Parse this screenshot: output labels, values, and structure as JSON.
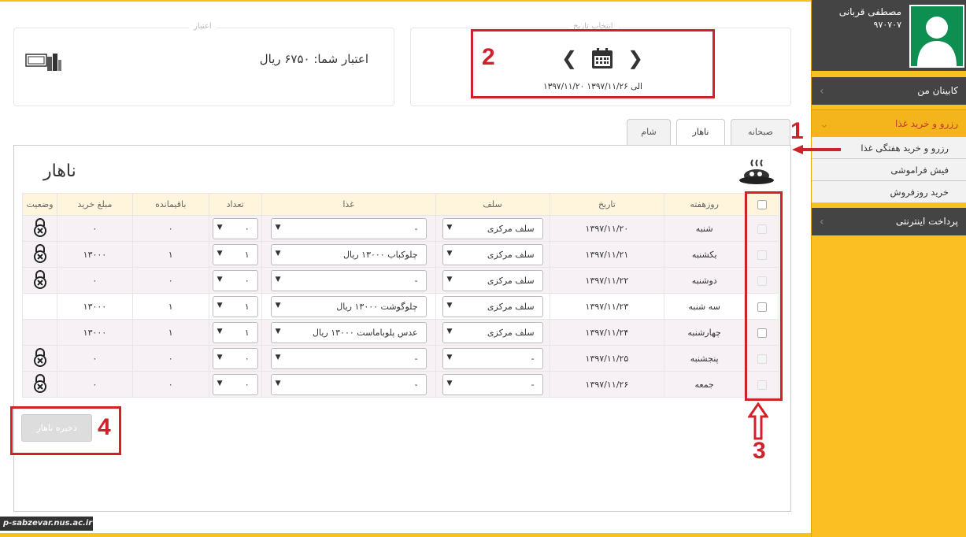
{
  "profile": {
    "name": "مصطفی قربانی",
    "id": "۹۷۰۷۰۷"
  },
  "menu": {
    "cabinet": "کابینان من",
    "reserve": "رزرو و خرید غذا",
    "sub": [
      "رزرو و خرید هفتگی غذا",
      "فیش فراموشی",
      "خرید روزفروش"
    ],
    "payment": "پرداخت اینترنتی"
  },
  "credit": {
    "legend": "اعتبار",
    "text": "اعتبار شما: ۶۷۵۰ ریال"
  },
  "date": {
    "legend": "انتخاب تاریخ",
    "range": "۱۳۹۷/۱۱/۲۰ الی ۱۳۹۷/۱۱/۲۶"
  },
  "tabs": [
    "صبحانه",
    "ناهار",
    "شام"
  ],
  "section_title": "ناهار",
  "table": {
    "headers": [
      "روزهفته",
      "تاریخ",
      "سلف",
      "غذا",
      "تعداد",
      "باقیمانده",
      "مبلغ خرید",
      "وضعیت"
    ],
    "rows": [
      {
        "day": "شنبه",
        "date": "۱۳۹۷/۱۱/۲۰",
        "self": "سلف مرکزی",
        "food": "-",
        "count": "۰",
        "remain": "۰",
        "price": "۰",
        "locked": true,
        "disabled": true
      },
      {
        "day": "یکشنبه",
        "date": "۱۳۹۷/۱۱/۲۱",
        "self": "سلف مرکزی",
        "food": "چلوکباب ۱۳۰۰۰ ریال",
        "count": "۱",
        "remain": "۱",
        "price": "۱۳۰۰۰",
        "locked": true,
        "disabled": true
      },
      {
        "day": "دوشنبه",
        "date": "۱۳۹۷/۱۱/۲۲",
        "self": "سلف مرکزی",
        "food": "-",
        "count": "۰",
        "remain": "۰",
        "price": "۰",
        "locked": true,
        "disabled": true
      },
      {
        "day": "سه شنبه",
        "date": "۱۳۹۷/۱۱/۲۳",
        "self": "سلف مرکزی",
        "food": "چلوگوشت ۱۳۰۰۰ ریال",
        "count": "۱",
        "remain": "۱",
        "price": "۱۳۰۰۰",
        "locked": false,
        "disabled": false
      },
      {
        "day": "چهارشنبه",
        "date": "۱۳۹۷/۱۱/۲۴",
        "self": "سلف مرکزی",
        "food": "عدس پلوباماست ۱۳۰۰۰ ریال",
        "count": "۱",
        "remain": "۱",
        "price": "۱۳۰۰۰",
        "locked": false,
        "disabled": false
      },
      {
        "day": "پنجشنبه",
        "date": "۱۳۹۷/۱۱/۲۵",
        "self": "-",
        "food": "-",
        "count": "۰",
        "remain": "۰",
        "price": "۰",
        "locked": true,
        "disabled": true
      },
      {
        "day": "جمعه",
        "date": "۱۳۹۷/۱۱/۲۶",
        "self": "-",
        "food": "-",
        "count": "۰",
        "remain": "۰",
        "price": "۰",
        "locked": true,
        "disabled": true
      }
    ]
  },
  "save_label": "ذخیره ناهار",
  "annotations": [
    "1",
    "2",
    "3",
    "4"
  ],
  "watermark": "p-sabzevar.nus.ac.ir",
  "colors": {
    "sidebar": "#fbbf24",
    "dark": "#444444",
    "annotation": "#d0202a",
    "avatar": "#0d8f51"
  }
}
